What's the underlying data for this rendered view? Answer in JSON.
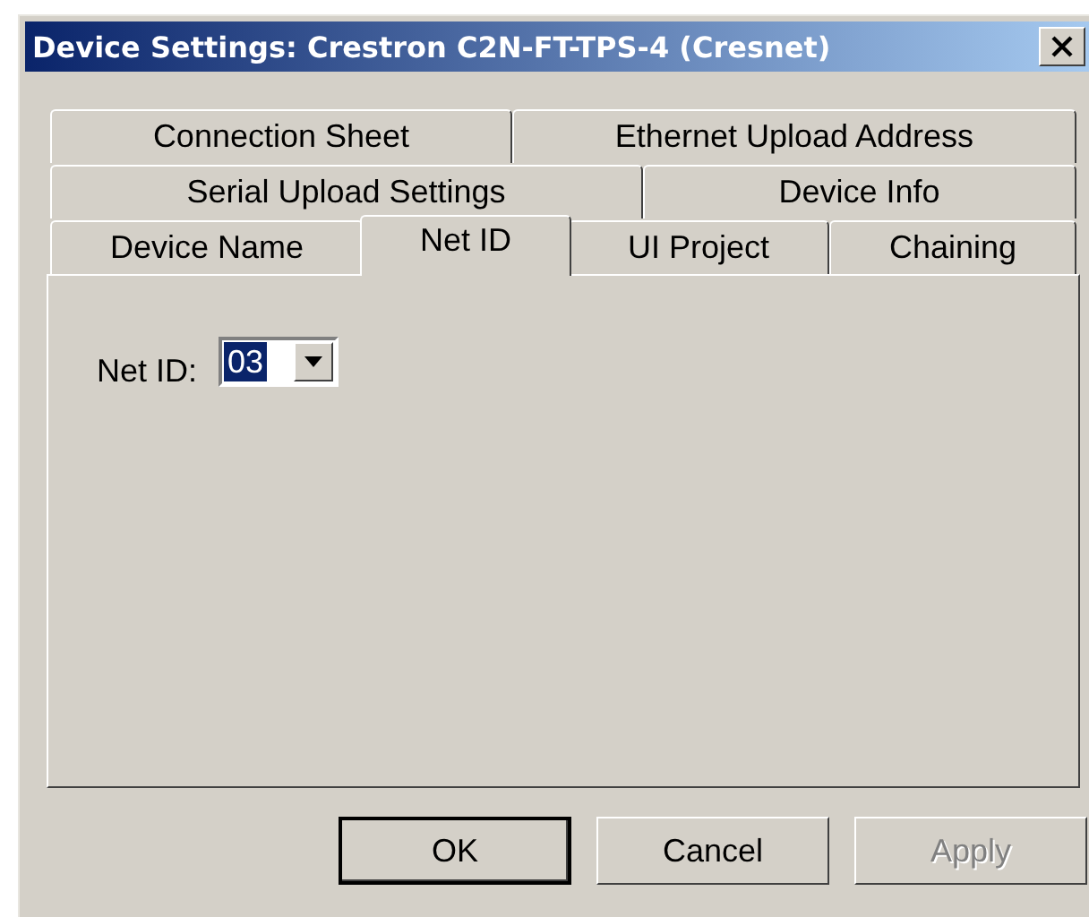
{
  "window": {
    "title": "Device Settings: Crestron C2N-FT-TPS-4 (Cresnet)"
  },
  "tab_rows": [
    [
      {
        "label": "Connection Sheet",
        "selected": false
      },
      {
        "label": "Ethernet Upload Address",
        "selected": false
      }
    ],
    [
      {
        "label": "Serial Upload Settings",
        "selected": false
      },
      {
        "label": "Device Info",
        "selected": false
      }
    ],
    [
      {
        "label": "Device Name",
        "selected": false
      },
      {
        "label": "Net ID",
        "selected": true
      },
      {
        "label": "UI Project",
        "selected": false
      },
      {
        "label": "Chaining",
        "selected": false
      }
    ]
  ],
  "net_id": {
    "label": "Net ID:",
    "value": "03"
  },
  "buttons": [
    {
      "label": "OK",
      "default": true,
      "disabled": false
    },
    {
      "label": "Cancel",
      "default": false,
      "disabled": false
    },
    {
      "label": "Apply",
      "default": false,
      "disabled": true
    }
  ]
}
